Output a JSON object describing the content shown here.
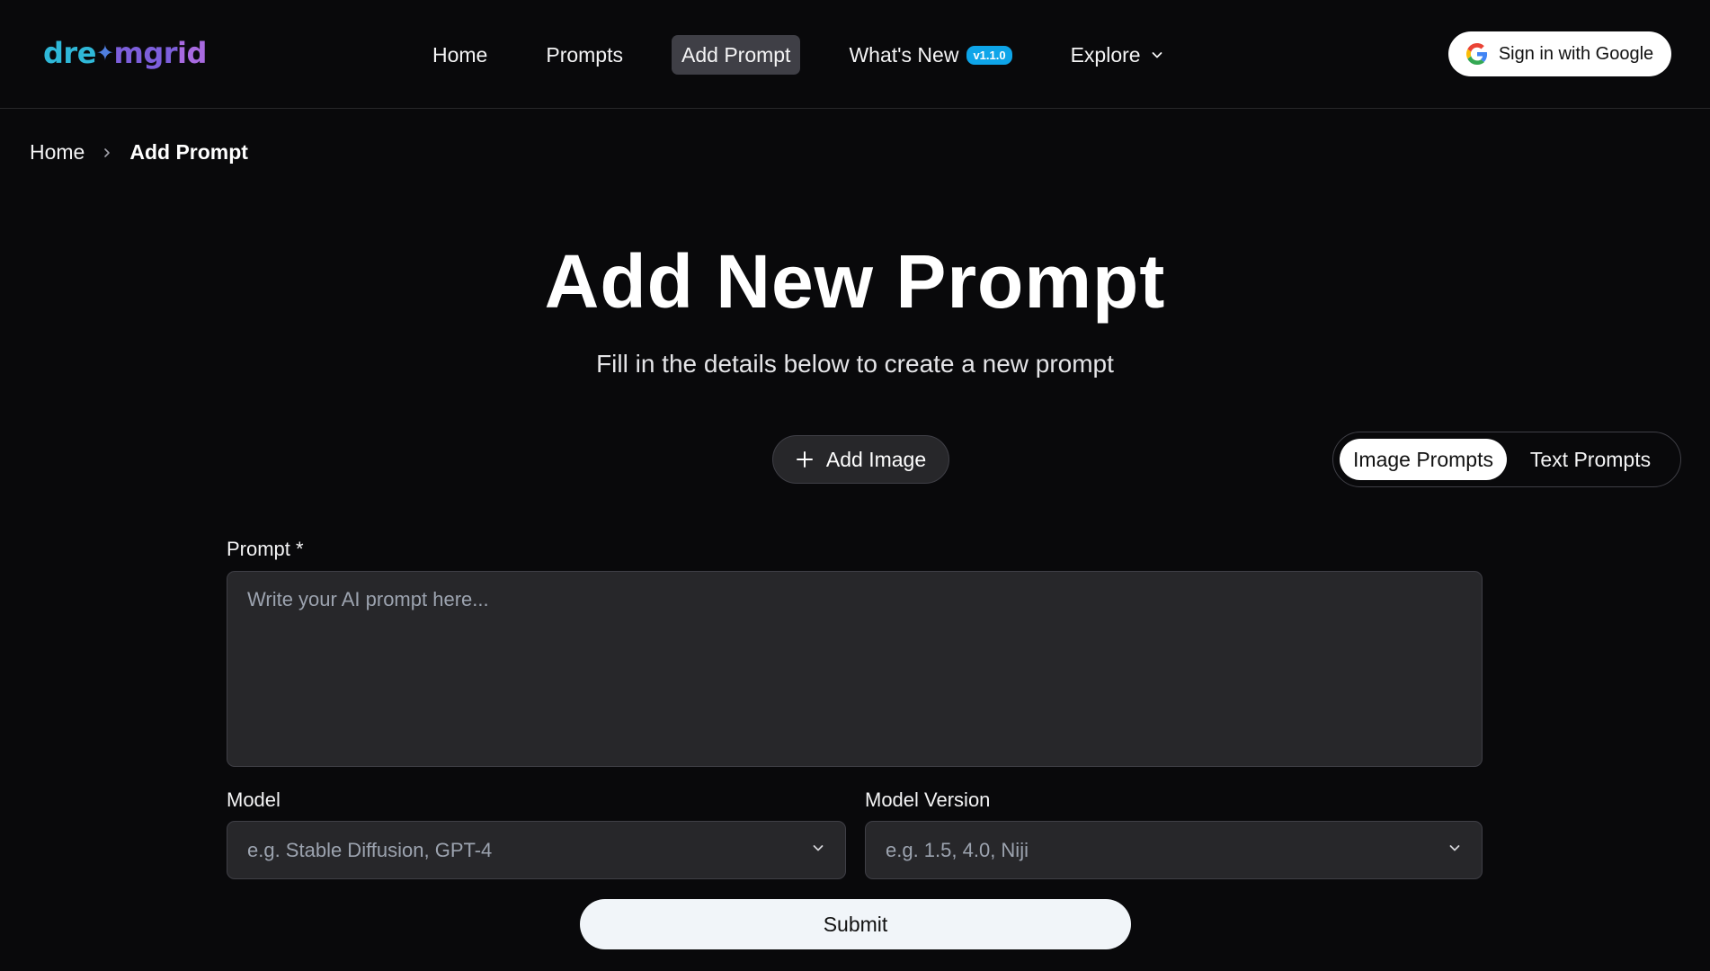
{
  "brand": {
    "logo_part1": "dre",
    "logo_star": "✦",
    "logo_part2": "mgr",
    "logo_part3": "id"
  },
  "nav": {
    "items": [
      {
        "label": "Home"
      },
      {
        "label": "Prompts"
      },
      {
        "label": "Add Prompt",
        "active": true
      },
      {
        "label": "What's New",
        "badge": "v1.1.0"
      },
      {
        "label": "Explore"
      }
    ],
    "signin_label": "Sign in with Google"
  },
  "breadcrumb": {
    "home": "Home",
    "current": "Add Prompt"
  },
  "hero": {
    "title": "Add New Prompt",
    "subtitle": "Fill in the details below to create a new prompt"
  },
  "actions": {
    "add_image_label": "Add Image",
    "toggle": {
      "options": [
        "Image Prompts",
        "Text Prompts"
      ],
      "selected": "Image Prompts"
    }
  },
  "form": {
    "prompt_label": "Prompt *",
    "prompt_placeholder": "Write your AI prompt here...",
    "prompt_value": "",
    "model_label": "Model",
    "model_placeholder": "e.g. Stable Diffusion, GPT-4",
    "version_label": "Model Version",
    "version_placeholder": "e.g. 1.5, 4.0, Niji",
    "submit_label": "Submit"
  },
  "colors": {
    "background": "#09090b",
    "surface": "#27272a",
    "border": "#3f3f46",
    "badge": "#0ea5e9",
    "logo_cyan": "#2fb8d8",
    "logo_purple": "#a86ae0"
  }
}
